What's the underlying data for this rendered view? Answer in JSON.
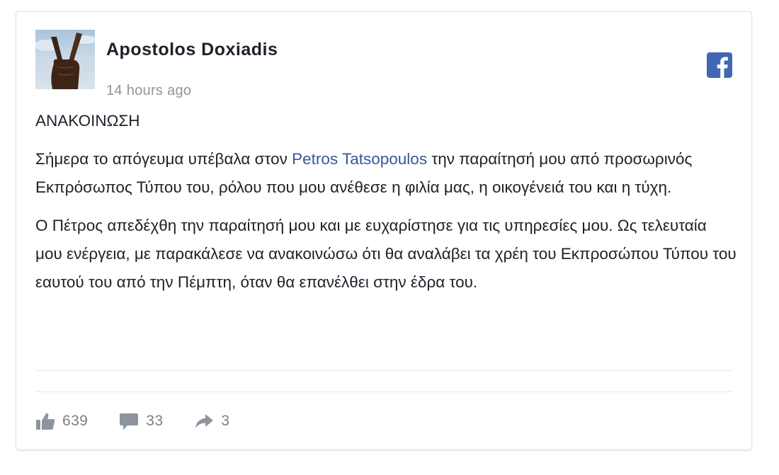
{
  "post": {
    "author": "Apostolos Doxiadis",
    "timestamp": "14 hours ago",
    "heading": "ΑΝΑΚΟΙΝΩΣΗ",
    "paragraph1": {
      "before": "Σήμερα το απόγευμα υπέβαλα στον ",
      "mention": "Petros Tatsopoulos",
      "after": " την παραίτησή μου από προσωρινός Εκπρόσωπος Τύπου του, ρόλου που μου ανέθεσε η φιλία μας, η οικογένειά του και η τύχη."
    },
    "paragraph2": "Ο Πέτρος απεδέχθη την παραίτησή μου και με ευχαρίστησε για τις υπηρεσίες μου. Ως τελευταία μου ενέργεια, με παρακάλεσε να ανακοινώσω ότι θα αναλάβει τα χρέη του Εκπροσώπου Τύπου του εαυτού του από την Πέμπτη, όταν θα επανέλθει στην έδρα του."
  },
  "stats": {
    "likes": "639",
    "comments": "33",
    "shares": "3"
  },
  "icons": {
    "platform": "facebook-icon",
    "like": "thumbs-up-icon",
    "comment": "speech-bubble-icon",
    "share": "share-arrow-icon"
  },
  "colors": {
    "brand": "#4267b2",
    "mention": "#365899",
    "muted": "#90949c"
  }
}
